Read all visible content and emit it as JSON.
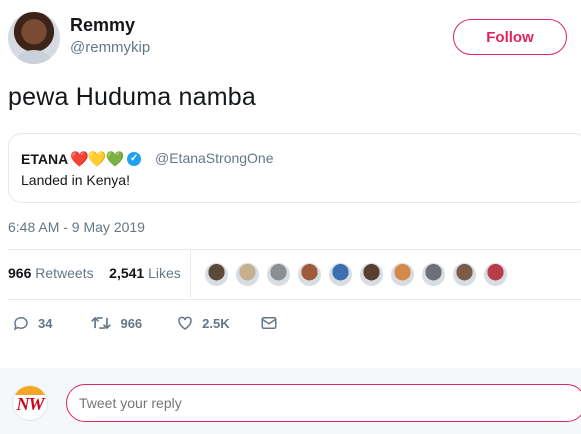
{
  "user": {
    "name": "Remmy",
    "handle": "@remmykip"
  },
  "follow_label": "Follow",
  "tweet": {
    "text": "pewa Huduma namba"
  },
  "quoted": {
    "name": "ETANA",
    "hearts": "❤️💛💚",
    "verified_glyph": "✓",
    "handle": "@EtanaStrongOne",
    "text": "Landed in Kenya!"
  },
  "timestamp": "6:48 AM - 9 May 2019",
  "stats": {
    "retweets_count": "966",
    "retweets_label": "Retweets",
    "likes_count": "2,541",
    "likes_label": "Likes"
  },
  "liker_avatar_colors": [
    "#5b4a3a",
    "#c7b08d",
    "#8a8f96",
    "#a05a3c",
    "#3c6fb0",
    "#5a3e30",
    "#d4894a",
    "#6f6f78",
    "#7c5c48",
    "#b83c4a"
  ],
  "actions": {
    "replies": "34",
    "retweets": "966",
    "likes": "2.5K"
  },
  "reply": {
    "avatar_text": "NW",
    "placeholder": "Tweet your reply"
  },
  "colors": {
    "accent": "#e0245e",
    "link": "#1da1f2",
    "muted": "#657786"
  }
}
